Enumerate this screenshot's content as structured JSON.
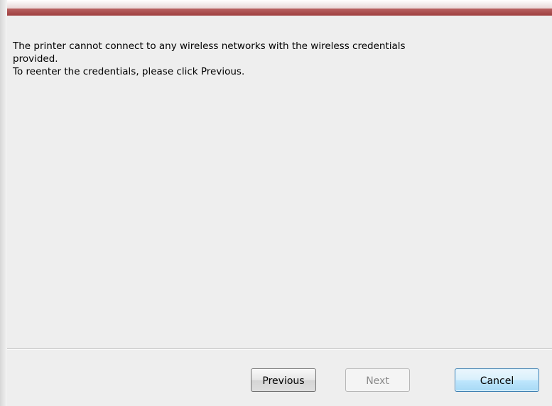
{
  "dialog": {
    "message": {
      "line1": "The printer cannot connect to any wireless networks with the wireless credentials",
      "line2": "provided.",
      "line3": "To reenter the credentials, please click Previous."
    },
    "buttons": {
      "previous": "Previous",
      "next": "Next",
      "cancel": "Cancel"
    },
    "states": {
      "next_enabled": false,
      "default_button": "cancel"
    }
  },
  "colors": {
    "accent_bar": "#a54646",
    "panel_background": "#eeeeee",
    "default_button_border": "#3c7fb1"
  }
}
